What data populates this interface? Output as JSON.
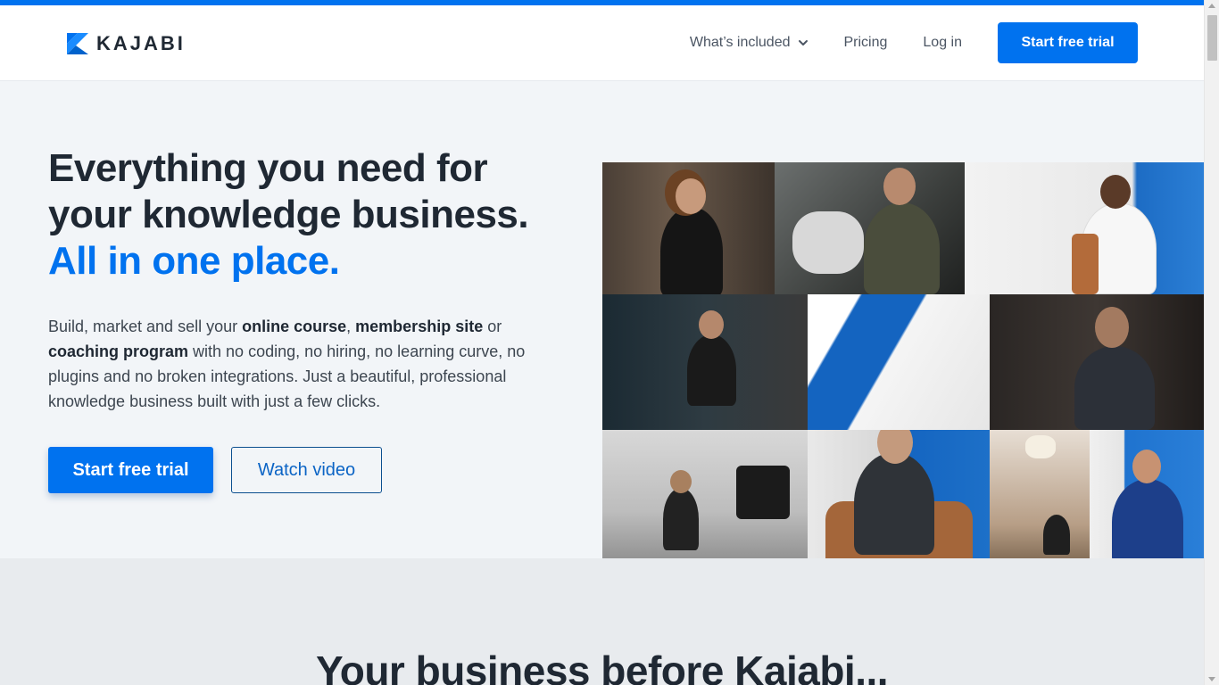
{
  "header": {
    "brand": "KAJABI",
    "brand_color": "#0072ef",
    "nav": {
      "whats_included": "What’s included",
      "pricing": "Pricing",
      "login": "Log in",
      "cta": "Start free trial"
    }
  },
  "hero": {
    "headline_line1": "Everything you need for",
    "headline_line2": "your knowledge business.",
    "headline_accent": "All in one place.",
    "body": {
      "t1": "Build, market and sell your ",
      "b1": "online course",
      "t2": ", ",
      "b2": "membership site",
      "t3": " or ",
      "b3": "coaching program",
      "t4": " with no coding, no hiring, no learning curve, no plugins and no broken integrations. Just a beautiful, professional knowledge business built with just a few clicks."
    },
    "primary_button": "Start free trial",
    "secondary_button": "Watch video"
  },
  "section2": {
    "heading": "Your business before Kajabi..."
  },
  "colors": {
    "accent": "#0072ef",
    "text_dark": "#1f2833",
    "hero_bg": "#f2f5f8",
    "section_bg": "#e8ebee"
  }
}
